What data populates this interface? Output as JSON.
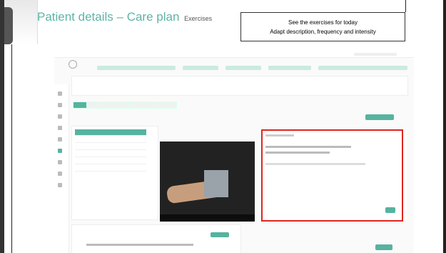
{
  "slide": {
    "title": "Patient details – Care plan",
    "title_suffix": "Exercises",
    "note_line1": "See the exercises for today",
    "note_line2": "Adapt description, frequency and intensity"
  },
  "colors": {
    "accent": "#5fb3a6",
    "highlight": "#e0251f",
    "app_green": "#56b3a0"
  }
}
